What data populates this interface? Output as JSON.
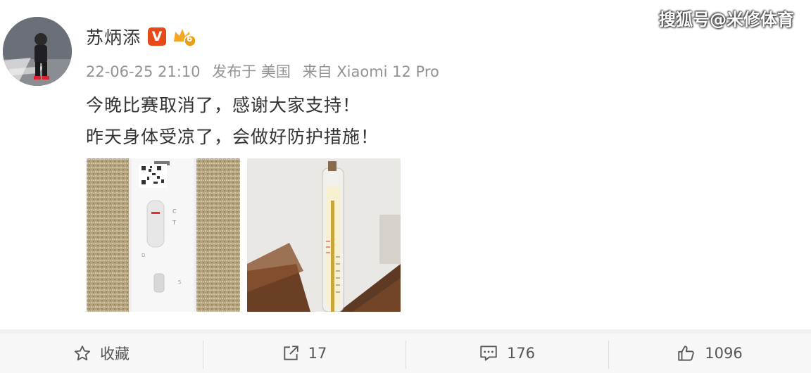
{
  "watermark": "搜狐号@米修体育",
  "post": {
    "author": "苏炳添",
    "verified_badge": "V",
    "level_badge": "6",
    "meta": {
      "timestamp": "22-06-25 21:10",
      "posted_from_label": "发布于 美国",
      "device_label": "来自 Xiaomi 12 Pro"
    },
    "lines": [
      "今晚比赛取消了，感谢大家支持！",
      "昨天身体受凉了，会做好防护措施！"
    ],
    "images": [
      {
        "name": "test-strip-photo"
      },
      {
        "name": "thermometer-photo"
      }
    ]
  },
  "actions": {
    "favorite": {
      "label": "收藏",
      "icon": "star-icon"
    },
    "share": {
      "count": "17",
      "icon": "share-icon"
    },
    "comment": {
      "count": "176",
      "icon": "comment-icon"
    },
    "like": {
      "count": "1096",
      "icon": "thumbs-up-icon"
    }
  },
  "colors": {
    "verified_badge": "#e64a19",
    "level_badge": "#f5a623",
    "meta_text": "#939393",
    "action_bar_bg": "#f7f7f7"
  }
}
